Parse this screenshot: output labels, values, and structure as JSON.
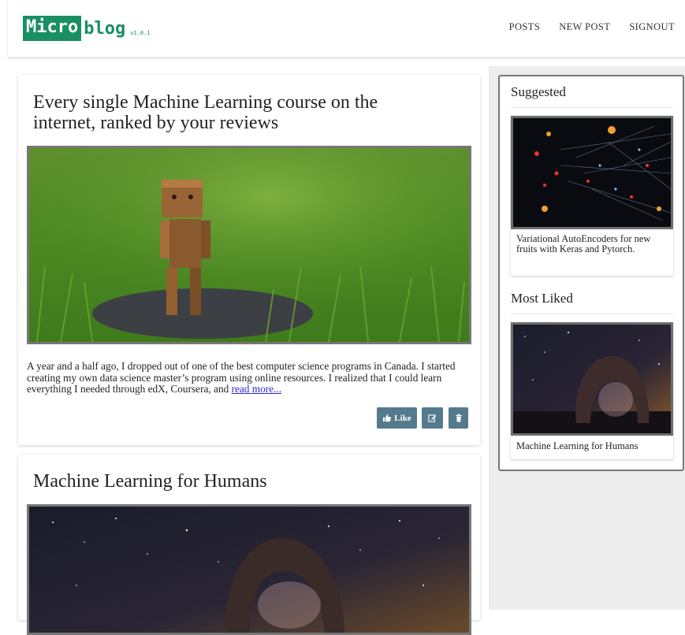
{
  "brand": {
    "box": "Micro",
    "rest": "blog",
    "version": "v1.0.1"
  },
  "nav": {
    "items": [
      "POSTS",
      "NEW POST",
      "SIGNOUT"
    ]
  },
  "posts": [
    {
      "title": "Every single Machine Learning course on the internet, ranked by your reviews",
      "image": "wooden-robot-on-grass",
      "excerpt": "A year and a half ago, I dropped out of one of the best computer science programs in Canada. I started creating my own data science master’s program using online resources. I realized that I could learn everything I needed through edX, Coursera, and ",
      "read_more": "read more...",
      "like_label": "Like"
    },
    {
      "title": "Machine Learning for Humans",
      "image": "night-sky-rock-arch"
    }
  ],
  "sidebar": {
    "suggested_heading": "Suggested",
    "suggested_caption": "Variational AutoEncoders for new fruits with Keras and Pytorch.",
    "most_liked_heading": "Most Liked",
    "most_liked_caption": "Machine Learning for Humans"
  },
  "icons": {
    "like": "thumbs-up-icon",
    "edit": "edit-icon",
    "delete": "trash-icon"
  },
  "colors": {
    "brand": "#1a8f63",
    "button": "#557a8e",
    "link": "#2a2ad0"
  }
}
